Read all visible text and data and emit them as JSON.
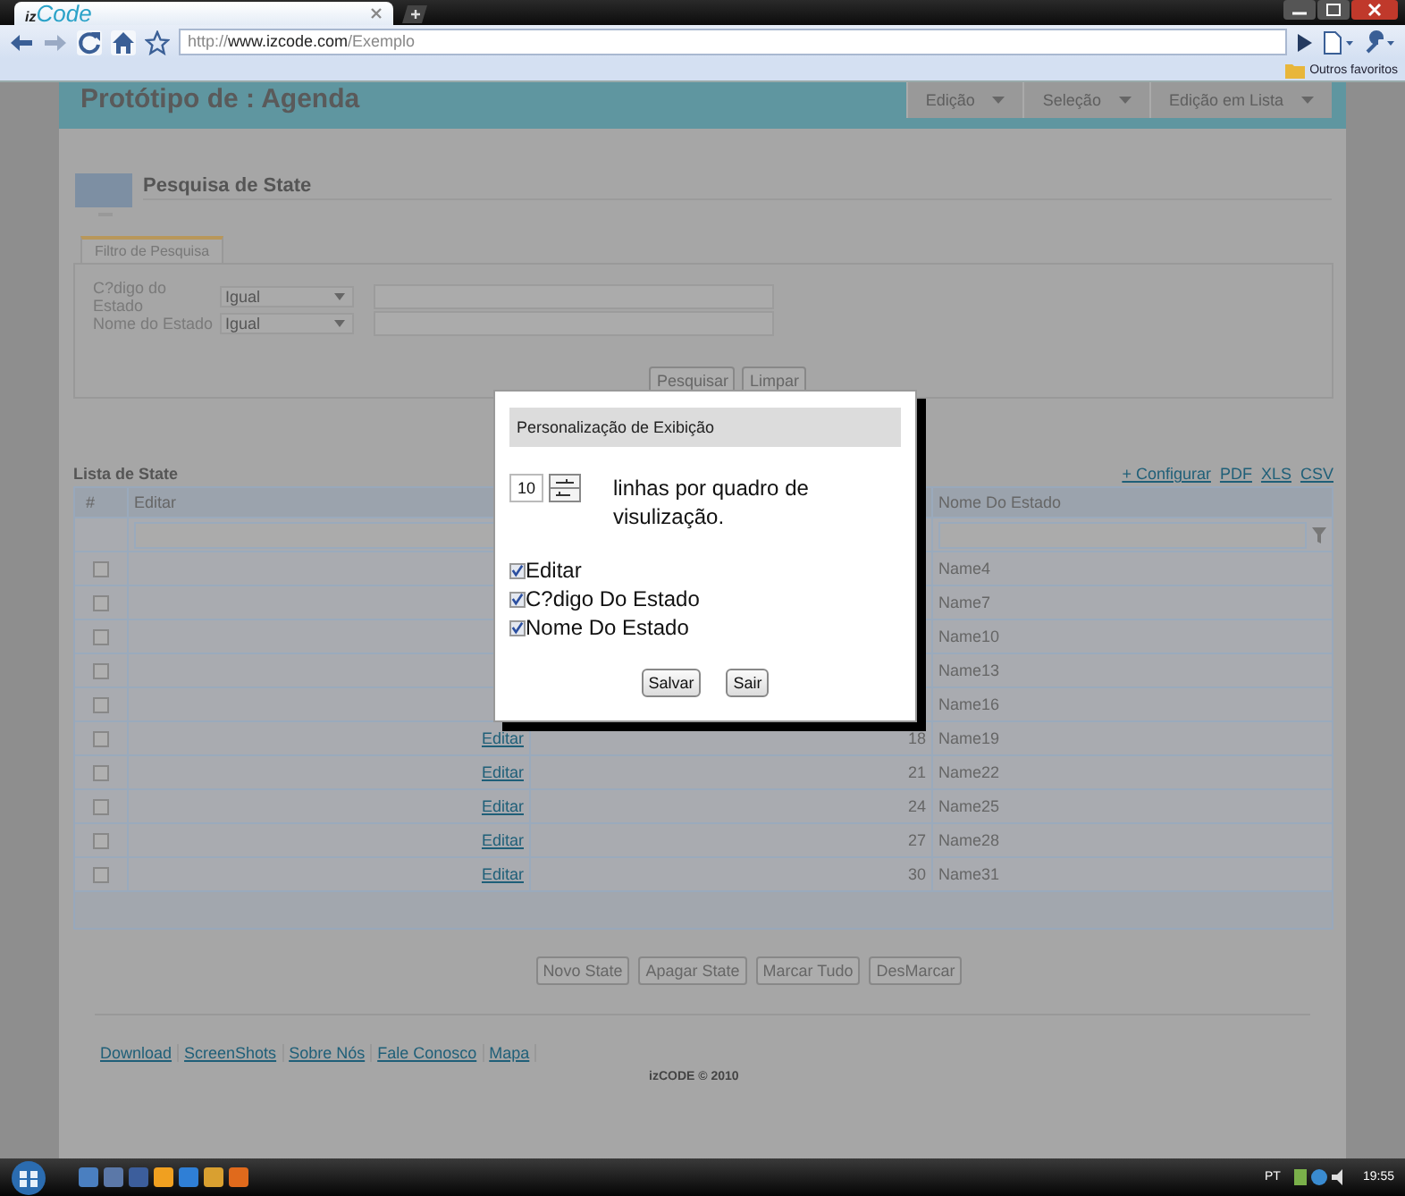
{
  "browser": {
    "tab_logo_prefix": "iz",
    "tab_logo_main": "Code",
    "url_scheme": "http://",
    "url_host": "www.izcode.com",
    "url_path": "/Exemplo",
    "bookmark_folder": "Outros favoritos"
  },
  "header": {
    "title": "Protótipo de : Agenda",
    "menus": [
      {
        "label": "Edição"
      },
      {
        "label": "Seleção"
      },
      {
        "label": "Edição em Lista"
      }
    ]
  },
  "search": {
    "title": "Pesquisa de State",
    "filter_tab": "Filtro de Pesquisa",
    "fields": [
      {
        "label": "C?digo do Estado",
        "operator": "Igual"
      },
      {
        "label": "Nome do Estado",
        "operator": "Igual"
      }
    ],
    "buttons": [
      "Pesquisar",
      "Limpar"
    ]
  },
  "list": {
    "title": "Lista de State",
    "links": [
      "+ Configurar",
      "PDF",
      "XLS",
      "CSV"
    ],
    "columns": [
      "#",
      "Editar",
      "Nome Do Estado"
    ],
    "rows": [
      {
        "checked": false,
        "name": "Name4"
      },
      {
        "checked": false,
        "name": "Name7"
      },
      {
        "checked": false,
        "name": "Name10"
      },
      {
        "checked": false,
        "name": "Name13"
      },
      {
        "checked": false,
        "name": "Name16"
      },
      {
        "checked": false,
        "edit": "Editar",
        "code": "18",
        "name": "Name19"
      },
      {
        "checked": false,
        "edit": "Editar",
        "code": "21",
        "name": "Name22"
      },
      {
        "checked": false,
        "edit": "Editar",
        "code": "24",
        "name": "Name25"
      },
      {
        "checked": false,
        "edit": "Editar",
        "code": "27",
        "name": "Name28"
      },
      {
        "checked": false,
        "edit": "Editar",
        "code": "30",
        "name": "Name31"
      }
    ]
  },
  "actions": [
    "Novo State",
    "Apagar State",
    "Marcar Tudo",
    "DesMarcar"
  ],
  "footer": {
    "links": [
      "Download",
      "ScreenShots",
      "Sobre Nós",
      "Fale Conosco",
      "Mapa"
    ],
    "copyright": "izCODE © 2010"
  },
  "dialog": {
    "title": "Personalização de Exibição",
    "rows_per_page": "10",
    "rows_text": "linhas por quadro de visulização.",
    "options": [
      {
        "label": "Editar",
        "checked": true
      },
      {
        "label": "C?digo Do Estado",
        "checked": true
      },
      {
        "label": "Nome Do Estado",
        "checked": true
      }
    ],
    "buttons": [
      "Salvar",
      "Sair"
    ]
  },
  "taskbar": {
    "language": "PT",
    "time": "19:55"
  }
}
